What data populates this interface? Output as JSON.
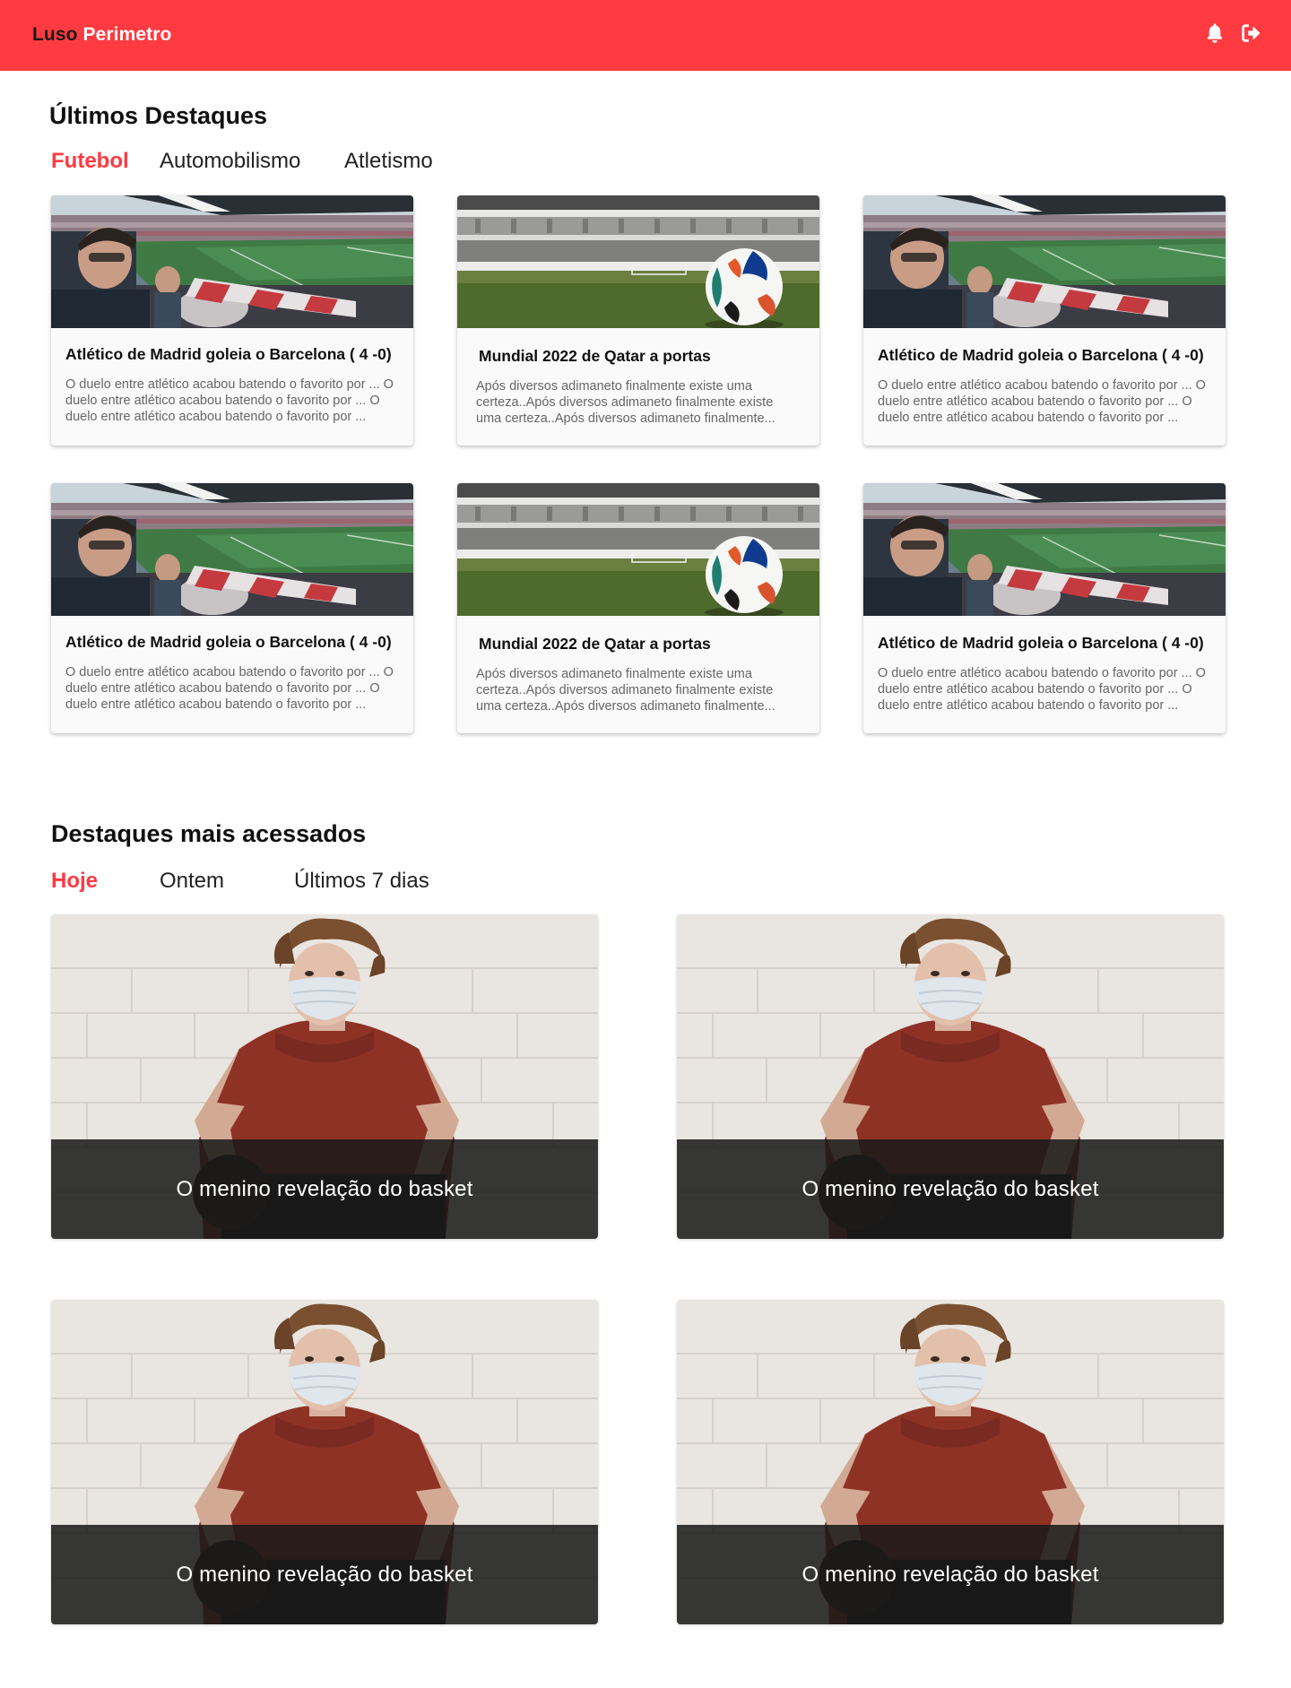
{
  "brand": {
    "part1": "Luso",
    "part2": "Perimetro",
    "color": "#ff3a40"
  },
  "header_icons": [
    "bell-icon",
    "logout-icon"
  ],
  "latest": {
    "title": "Últimos Destaques",
    "tabs": [
      "Futebol",
      "Automobilismo",
      "Atletismo"
    ],
    "active_tab": "Futebol",
    "cards": [
      {
        "image": "stadium-crowd",
        "title": "Atlético de Madrid goleia o Barcelona ( 4 -0)",
        "text": "O duelo entre atlético acabou batendo o favorito por ... O duelo entre atlético acabou batendo o favorito por ... O duelo entre atlético acabou batendo o favorito por ..."
      },
      {
        "image": "football-pitch",
        "title": "Mundial 2022 de Qatar a portas",
        "text": "Após diversos adimaneto finalmente existe uma certeza..Após diversos adimaneto finalmente existe uma certeza..Após diversos adimaneto finalmente..."
      },
      {
        "image": "stadium-crowd",
        "title": "Atlético de Madrid goleia o Barcelona ( 4 -0)",
        "text": "O duelo entre atlético acabou batendo o favorito por ... O duelo entre atlético acabou batendo o favorito por ... O duelo entre atlético acabou batendo o favorito por ..."
      },
      {
        "image": "stadium-crowd",
        "title": "Atlético de Madrid goleia o Barcelona ( 4 -0)",
        "text": "O duelo entre atlético acabou batendo o favorito por ... O duelo entre atlético acabou batendo o favorito por ... O duelo entre atlético acabou batendo o favorito por ..."
      },
      {
        "image": "football-pitch",
        "title": "Mundial 2022 de Qatar a portas",
        "text": "Após diversos adimaneto finalmente existe uma certeza..Após diversos adimaneto finalmente existe uma certeza..Após diversos adimaneto finalmente..."
      },
      {
        "image": "stadium-crowd",
        "title": "Atlético de Madrid goleia o Barcelona ( 4 -0)",
        "text": "O duelo entre atlético acabou batendo o favorito por ... O duelo entre atlético acabou batendo o favorito por ... O duelo entre atlético acabou batendo o favorito por ..."
      }
    ]
  },
  "most_accessed": {
    "title": "Destaques mais acessados",
    "tabs": [
      "Hoje",
      "Ontem",
      "Últimos 7 dias"
    ],
    "active_tab": "Hoje",
    "tiles": [
      {
        "image": "basketball-player",
        "caption": "O menino revelação do basket"
      },
      {
        "image": "basketball-player",
        "caption": "O menino revelação do basket"
      },
      {
        "image": "basketball-player",
        "caption": "O menino revelação do basket"
      },
      {
        "image": "basketball-player",
        "caption": "O menino revelação do basket"
      }
    ]
  }
}
